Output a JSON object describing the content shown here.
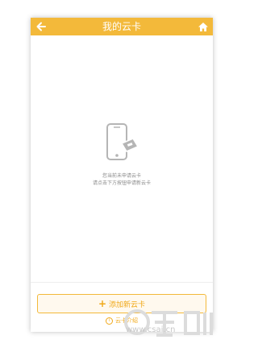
{
  "header": {
    "title": "我的云卡",
    "back_icon": "arrow-left-icon",
    "home_icon": "home-icon"
  },
  "empty_state": {
    "icon": "phone-card-icon",
    "line1": "您当前未申请云卡",
    "line2": "请点击下方按钮申请新云卡"
  },
  "footer": {
    "add_button_label": "添加新云卡",
    "add_icon": "plus-icon",
    "intro_label": "云卡介绍",
    "intro_icon": "info-icon"
  },
  "watermark": {
    "text": "www.csai.cn"
  },
  "colors": {
    "accent": "#f3b93a",
    "accent_text": "#f0a818",
    "muted_text": "#8a8a8a"
  }
}
